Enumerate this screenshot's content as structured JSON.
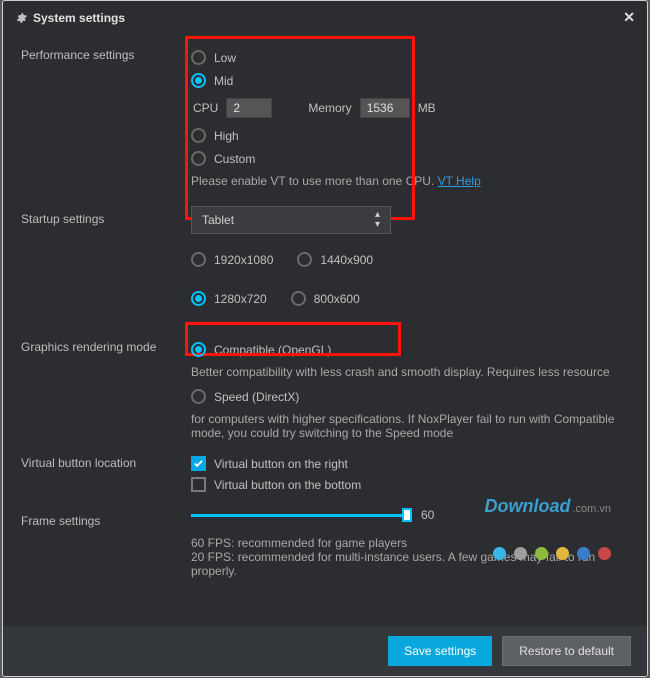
{
  "title": "System settings",
  "sections": {
    "performance": {
      "label": "Performance settings",
      "options": {
        "low": "Low",
        "mid": "Mid",
        "high": "High",
        "custom": "Custom"
      },
      "cpu_label": "CPU",
      "cpu_value": "2",
      "mem_label": "Memory",
      "mem_value": "1536",
      "mem_unit": "MB",
      "help": "Please enable VT to use more than one CPU.",
      "help_link": "VT Help"
    },
    "startup": {
      "label": "Startup settings",
      "selected": "Tablet",
      "resolutions": {
        "r1": "1920x1080",
        "r2": "1440x900",
        "r3": "1280x720",
        "r4": "800x600"
      }
    },
    "graphics": {
      "label": "Graphics rendering mode",
      "compatible": "Compatible (OpenGL)",
      "compat_desc": "Better compatibility with less crash and smooth display. Requires less resource",
      "speed": "Speed (DirectX)",
      "speed_desc": "for computers with higher specifications. If NoxPlayer fail to run with Compatible mode, you could try switching to the Speed mode"
    },
    "vbutton": {
      "label": "Virtual button location",
      "right": "Virtual button on the right",
      "bottom": "Virtual button on the bottom"
    },
    "frame": {
      "label": "Frame settings",
      "value": "60",
      "desc1": "60 FPS: recommended for game players",
      "desc2": "20 FPS: recommended for multi-instance users. A few games may fail to run properly."
    }
  },
  "footer": {
    "save": "Save settings",
    "restore": "Restore to default"
  },
  "watermark": {
    "main": "Download",
    "ext": ".com.vn"
  },
  "dot_colors": [
    "#38b7e4",
    "#9e9e9e",
    "#8fbb3b",
    "#e4b83c",
    "#3b7cc7",
    "#c94747"
  ]
}
